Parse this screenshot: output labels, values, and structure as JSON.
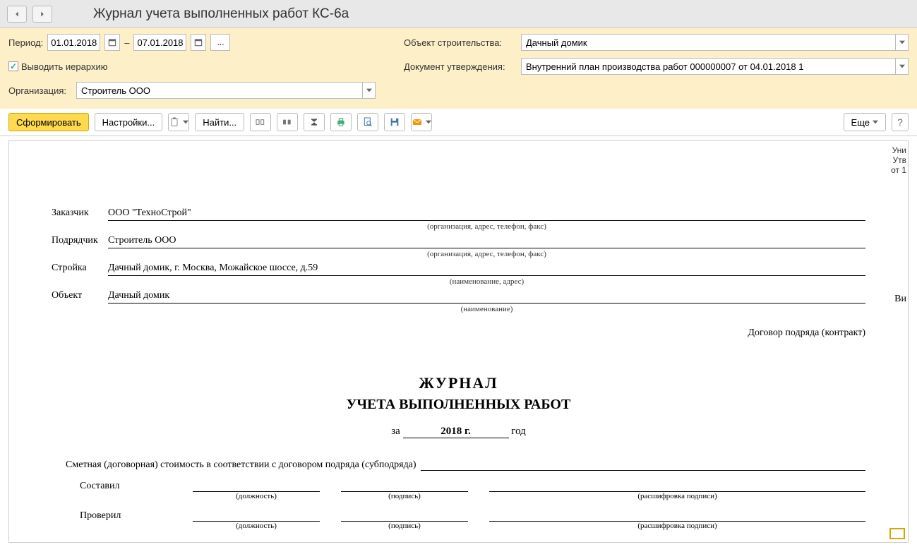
{
  "header": {
    "title": "Журнал учета выполненных работ КС-6а"
  },
  "params": {
    "period_label": "Период:",
    "date_from": "01.01.2018",
    "date_to": "07.01.2018",
    "dash": "–",
    "dots": "...",
    "hierarchy_label": "Выводить иерархию",
    "org_label": "Организация:",
    "org_value": "Строитель ООО",
    "object_label": "Объект строительства:",
    "object_value": "Дачный домик",
    "doc_label": "Документ утверждения:",
    "doc_value": "Внутренний план производства работ 000000007 от 04.01.2018 1"
  },
  "toolbar": {
    "generate": "Сформировать",
    "settings": "Настройки...",
    "find": "Найти...",
    "more": "Еще",
    "help": "?"
  },
  "report": {
    "meta_line1": "Уни",
    "meta_line2": "Утв",
    "meta_line3": "от 1",
    "customer_label": "Заказчик",
    "customer_value": "ООО \"ТехноСтрой\"",
    "org_hint": "(организация, адрес, телефон, факс)",
    "contractor_label": "Подрядчик",
    "contractor_value": "Строитель ООО",
    "site_label": "Стройка",
    "site_value": "Дачный домик, г. Москва, Можайское шоссе, д.59",
    "site_hint": "(наименование, адрес)",
    "object_label": "Объект",
    "object_value": "Дачный домик",
    "object_hint": "(наименование)",
    "vid_label": "Ви",
    "contract_label": "Договор подряда (контракт)",
    "j_title": "ЖУРНАЛ",
    "j_subtitle": "УЧЕТА ВЫПОЛНЕННЫХ РАБОТ",
    "j_period_prefix": "за",
    "j_period_year": "2018 г.",
    "j_period_suffix": "год",
    "estimate_label": "Сметная (договорная) стоимость в соответствии с договором подряда (субподряда)",
    "compiled_label": "Составил",
    "checked_label": "Проверил",
    "position_hint": "(должность)",
    "signature_hint": "(подпись)",
    "decipher_hint": "(расшифровка подписи)"
  }
}
